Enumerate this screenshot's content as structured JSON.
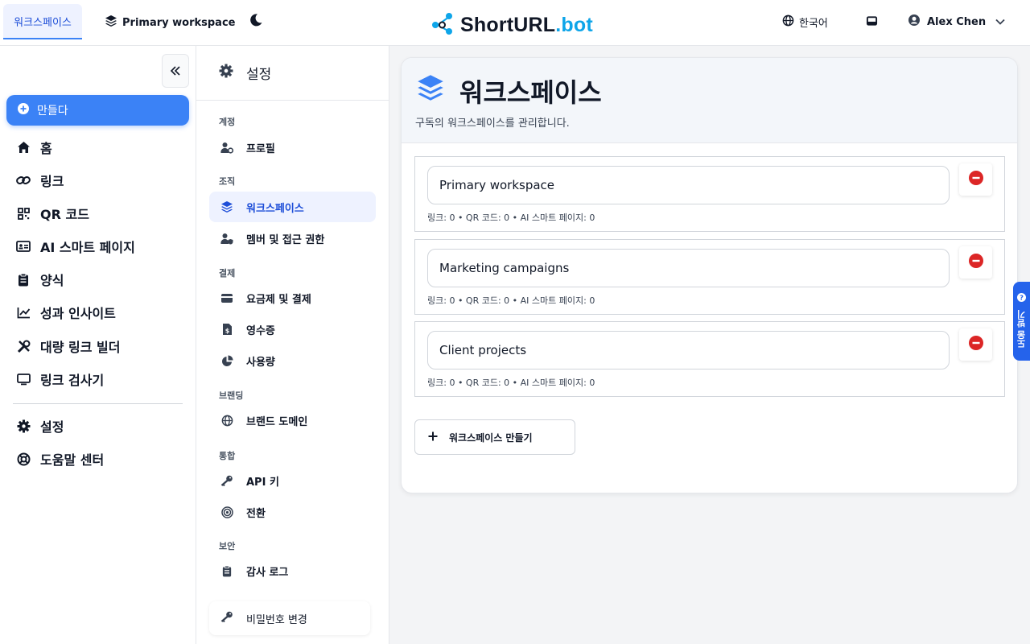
{
  "topbar": {
    "workspace_tab": "워크스페이스",
    "workspace_name": "Primary workspace",
    "brand_main": "ShortURL",
    "brand_dot": ".bot",
    "language": "한국어",
    "user_name": "Alex Chen"
  },
  "sidebar": {
    "create_label": "만들다",
    "items": [
      {
        "label": "홈",
        "icon": "home-icon"
      },
      {
        "label": "링크",
        "icon": "link-icon"
      },
      {
        "label": "QR 코드",
        "icon": "qr-code-icon"
      },
      {
        "label": "AI 스마트 페이지",
        "icon": "id-card-icon"
      },
      {
        "label": "양식",
        "icon": "clipboard-icon"
      },
      {
        "label": "성과 인사이트",
        "icon": "chart-line-icon"
      },
      {
        "label": "대량 링크 빌더",
        "icon": "tools-icon"
      },
      {
        "label": "링크 검사기",
        "icon": "monitor-icon"
      }
    ],
    "bottom_items": [
      {
        "label": "설정",
        "icon": "gear-icon"
      },
      {
        "label": "도움말 센터",
        "icon": "lifebuoy-icon"
      }
    ]
  },
  "settings": {
    "title": "설정",
    "sections": {
      "account": "계정",
      "organization": "조직",
      "billing": "결제",
      "branding": "브랜딩",
      "integrations": "통합",
      "security": "보안"
    },
    "items": {
      "profile": "프로필",
      "workspaces": "워크스페이스",
      "members": "멤버 및 접근 권한",
      "plans": "요금제 및 결제",
      "receipts": "영수증",
      "usage": "사용량",
      "brand_domains": "브랜드 도메인",
      "api_keys": "API 키",
      "conversions": "전환",
      "audit_log": "감사 로그"
    },
    "change_password": "비밀번호 변경"
  },
  "main": {
    "title": "워크스페이스",
    "subtitle": "구독의 워크스페이스를 관리합니다.",
    "workspaces": [
      {
        "name": "Primary workspace",
        "stats": "링크: 0 • QR 코드: 0 • AI 스마트 페이지: 0"
      },
      {
        "name": "Marketing campaigns",
        "stats": "링크: 0 • QR 코드: 0 • AI 스마트 페이지: 0"
      },
      {
        "name": "Client projects",
        "stats": "링크: 0 • QR 코드: 0 • AI 스마트 페이지: 0"
      }
    ],
    "add_button": "워크스페이스 만들기"
  },
  "help_tab": "도움 받기",
  "colors": {
    "accent": "#3b82f6",
    "danger": "#dc2626",
    "brand_dot": "#0ea5e9"
  }
}
